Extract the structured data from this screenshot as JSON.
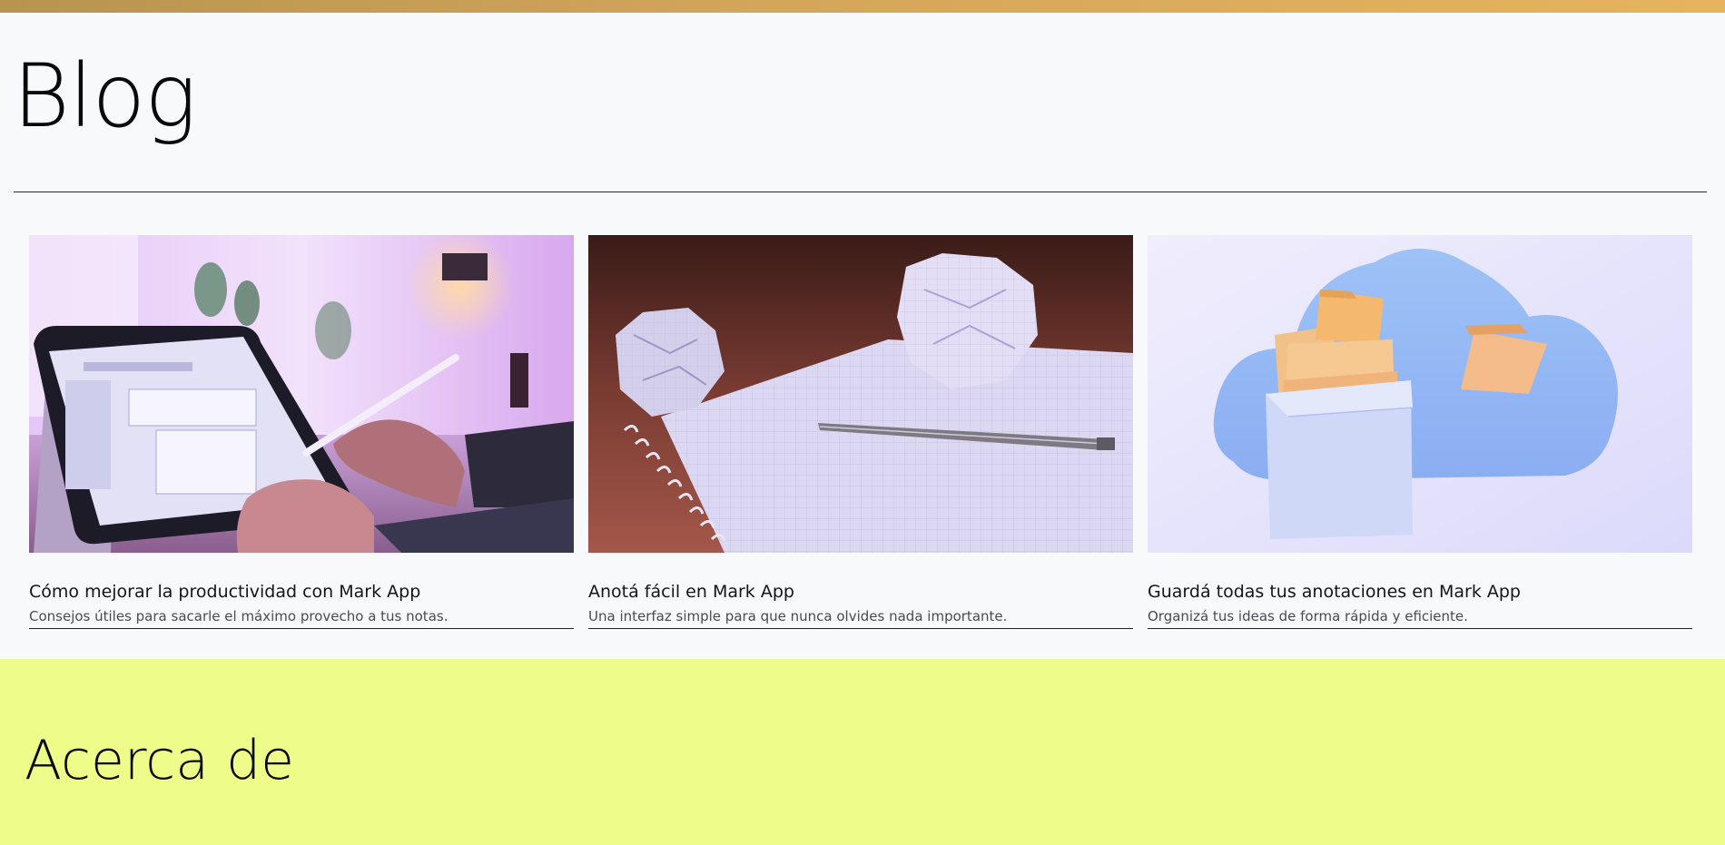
{
  "blog": {
    "title": "Blog",
    "posts": [
      {
        "title": "Cómo mejorar la productividad con Mark App",
        "description": "Consejos útiles para sacarle el máximo provecho a tus notas.",
        "image_alt": "tablet-with-stylus-photo"
      },
      {
        "title": "Anotá fácil en Mark App",
        "description": "Una interfaz simple para que nunca olvides nada importante.",
        "image_alt": "notebook-and-pen-photo"
      },
      {
        "title": "Guardá todas tus anotaciones en Mark App",
        "description": "Organizá tus ideas de forma rápida y eficiente.",
        "image_alt": "cloud-folders-illustration"
      }
    ]
  },
  "about": {
    "title": "Acerca de"
  },
  "colors": {
    "top_bar": "#d4a65a",
    "background": "#f8f9fb",
    "about_background": "#eefd8a"
  }
}
